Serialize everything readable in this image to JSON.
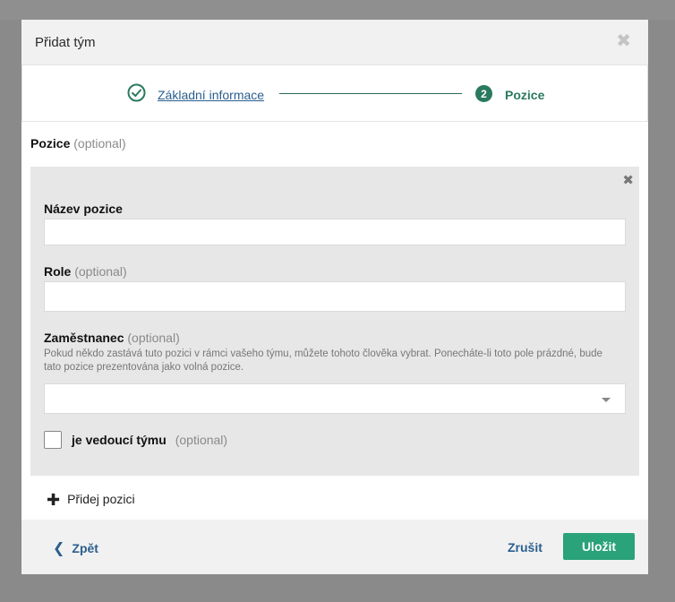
{
  "modal": {
    "title": "Přidat tým",
    "close_symbol": "✖"
  },
  "stepper": {
    "step1": {
      "label": "Základní informace",
      "icon": "check-circle-icon"
    },
    "step2": {
      "number": "2",
      "label": "Pozice"
    }
  },
  "section": {
    "title": "Pozice",
    "optional": "(optional)"
  },
  "position_panel": {
    "remove_symbol": "✖",
    "name_label": "Název pozice",
    "name_value": "",
    "role_label": "Role",
    "role_optional": "(optional)",
    "role_value": "",
    "employee_label": "Zaměstnanec",
    "employee_optional": "(optional)",
    "employee_help": "Pokud někdo zastává tuto pozici v rámci vašeho týmu, můžete tohoto člověka vybrat. Ponecháte-li toto pole prázdné, bude tato pozice prezentována jako volná pozice.",
    "employee_value": "",
    "leader_label": "je vedoucí týmu",
    "leader_optional": "(optional)",
    "leader_checked": false
  },
  "add_position": {
    "symbol": "✚",
    "label": "Přidej pozici"
  },
  "footer": {
    "back_symbol": "❮",
    "back_label": "Zpět",
    "cancel_label": "Zrušit",
    "save_label": "Uložit"
  },
  "colors": {
    "accent_green": "#2aa27a",
    "step_green": "#2a7a5e",
    "link_blue": "#2a5f8f"
  }
}
